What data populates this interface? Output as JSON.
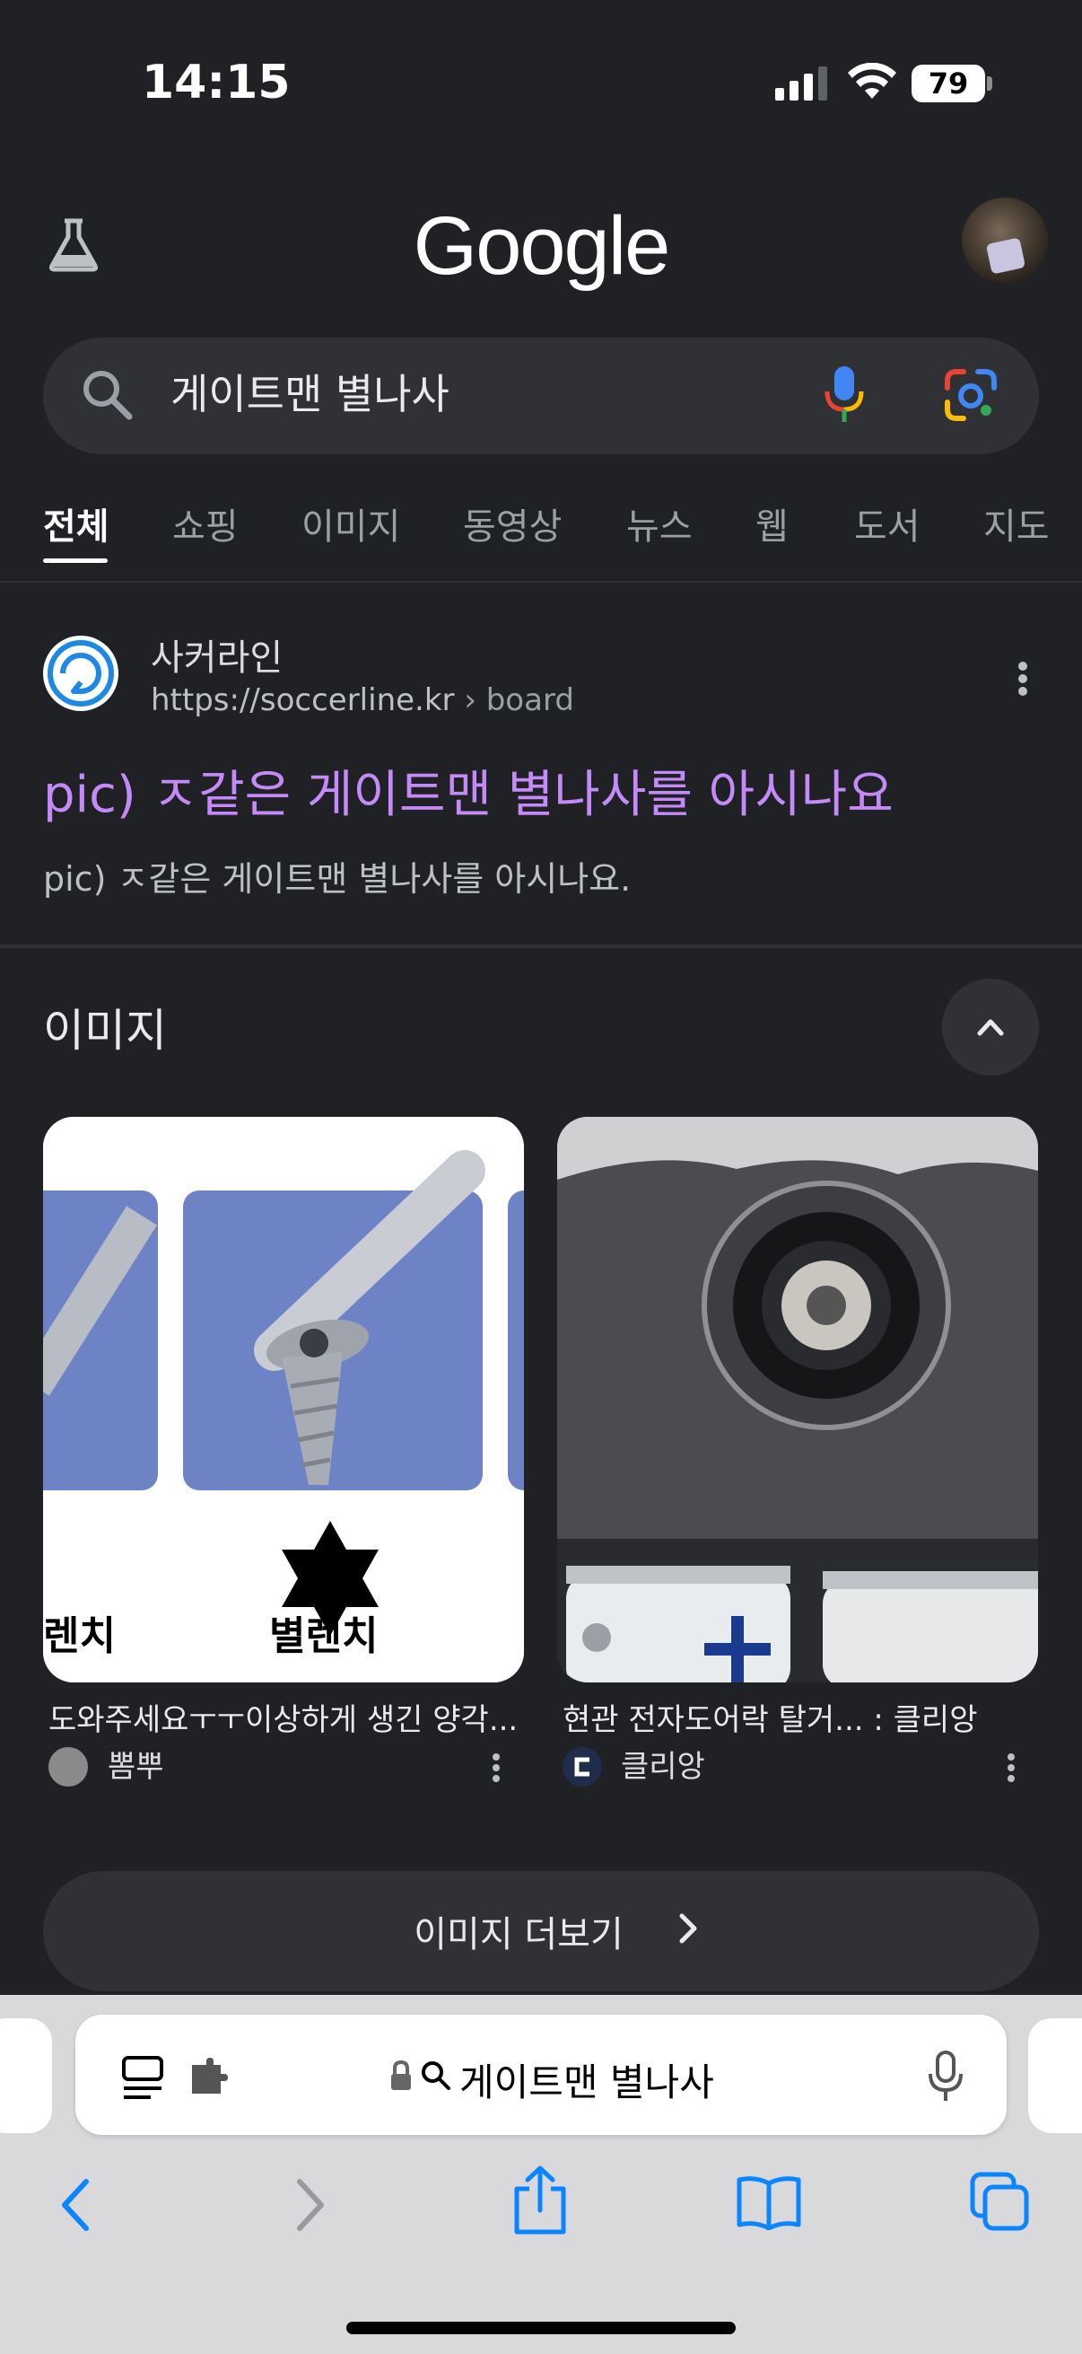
{
  "status_bar": {
    "time": "14:15",
    "battery": "79"
  },
  "header": {
    "logo": "Google"
  },
  "search": {
    "query": "게이트맨 별나사"
  },
  "tabs": [
    "전체",
    "쇼핑",
    "이미지",
    "동영상",
    "뉴스",
    "웹",
    "도서",
    "지도"
  ],
  "result": {
    "site_name": "사커라인",
    "site_url": "https://soccerline.kr",
    "site_path": " › board",
    "title": "pic) ㅈ같은 게이트맨 별나사를 아시나요",
    "snippet": "pic) ㅈ같은 게이트맨 별나사를 아시나요."
  },
  "images_section": {
    "heading": "이미지",
    "cards": [
      {
        "caption": "도와주세요ㅜㅜ이상하게 생긴 양각...",
        "source": "뽐뿌",
        "img_labels": [
          "렌치",
          "별렌치"
        ]
      },
      {
        "caption": "현관 전자도어락 탈거... : 클리앙",
        "source": "클리앙"
      }
    ],
    "more_button": "이미지 더보기"
  },
  "safari": {
    "address": "게이트맨 별나사"
  },
  "colors": {
    "background": "#202124",
    "link_visited": "#c58af9",
    "safari_bar": "#d9d9dc",
    "ios_blue": "#0a84ff"
  }
}
